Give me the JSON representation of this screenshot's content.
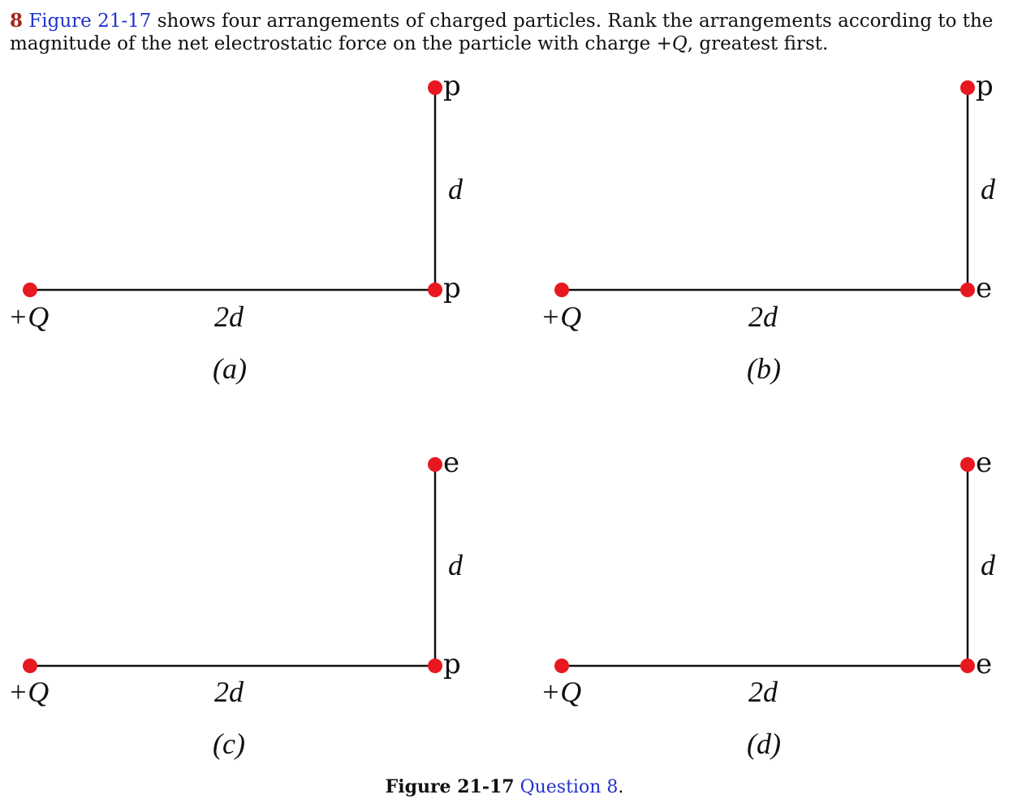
{
  "question": {
    "number": "8",
    "figure_ref": "Figure 21-17",
    "text_1": " shows four arrangements of charged particles. Rank the arrangements according to the magnitude of the net electrostatic force on the particle with charge +",
    "charge_symbol": "Q",
    "text_2": ", greatest first."
  },
  "figure": {
    "panels": [
      {
        "label": "(a)",
        "left_charge": "+Q",
        "horizontal_distance": "2d",
        "vertical_distance": "d",
        "corner_particle": "p",
        "top_particle": "p"
      },
      {
        "label": "(b)",
        "left_charge": "+Q",
        "horizontal_distance": "2d",
        "vertical_distance": "d",
        "corner_particle": "e",
        "top_particle": "p"
      },
      {
        "label": "(c)",
        "left_charge": "+Q",
        "horizontal_distance": "2d",
        "vertical_distance": "d",
        "corner_particle": "p",
        "top_particle": "e"
      },
      {
        "label": "(d)",
        "left_charge": "+Q",
        "horizontal_distance": "2d",
        "vertical_distance": "d",
        "corner_particle": "e",
        "top_particle": "e"
      }
    ],
    "colors": {
      "particle": "#e81820",
      "line": "#111111",
      "link": "#2233cc",
      "question_number": "#a0281f"
    }
  },
  "caption": {
    "figure_label": "Figure 21-17",
    "link_text": "Question 8",
    "end": "."
  }
}
